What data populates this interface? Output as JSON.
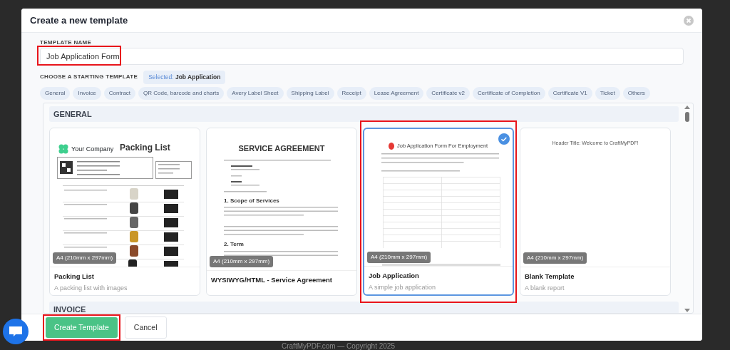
{
  "background": {
    "footer_text": "CraftMyPDF.com — Copyright 2025"
  },
  "modal": {
    "title": "Create a new template"
  },
  "template_name": {
    "label": "TEMPLATE NAME",
    "value": "Job Application Form",
    "annotated": true
  },
  "chooser": {
    "label": "CHOOSE A STARTING TEMPLATE",
    "selected_prefix": "Selected:",
    "selected_name": "Job Application"
  },
  "categories": [
    {
      "label": "General"
    },
    {
      "label": "Invoice"
    },
    {
      "label": "Contract"
    },
    {
      "label": "QR Code, barcode and charts"
    },
    {
      "label": "Avery Label Sheet"
    },
    {
      "label": "Shipping Label"
    },
    {
      "label": "Receipt"
    },
    {
      "label": "Lease Agreement"
    },
    {
      "label": "Certificate v2"
    },
    {
      "label": "Certificate of Completion"
    },
    {
      "label": "Certificate V1"
    },
    {
      "label": "Ticket"
    },
    {
      "label": "Others"
    }
  ],
  "sections": [
    {
      "heading": "GENERAL",
      "templates": [
        {
          "kind": "packing",
          "title": "Packing List",
          "description": "A packing list with images",
          "size": "A4 (210mm x 297mm)",
          "selected": false,
          "annotated": false,
          "preview": {
            "company": "Your Company",
            "heading": "Packing List"
          }
        },
        {
          "kind": "agreement",
          "title": "WYSIWYG/HTML - Service Agreement",
          "size": "A4 (210mm x 297mm)",
          "selected": false,
          "annotated": false,
          "preview": {
            "heading": "SERVICE AGREEMENT",
            "subheadings": [
              "1. Scope of Services",
              "2. Term"
            ]
          }
        },
        {
          "kind": "job",
          "title": "Job Application",
          "description": "A simple job application",
          "size": "A4 (210mm x 297mm)",
          "selected": true,
          "annotated": true,
          "preview": {
            "heading": "Job Application Form For Employment"
          }
        },
        {
          "kind": "blank",
          "title": "Blank Template",
          "description": "A blank report",
          "size": "A4 (210mm x 297mm)",
          "selected": false,
          "annotated": false,
          "preview": {
            "heading": "Header Title: Welcome to CraftMyPDF!"
          }
        }
      ]
    },
    {
      "heading": "INVOICE"
    }
  ],
  "footer": {
    "buttons": [
      {
        "label": "Create Template",
        "kind": "primary",
        "annotated": true
      },
      {
        "label": "Cancel",
        "kind": "secondary",
        "annotated": false
      }
    ]
  }
}
